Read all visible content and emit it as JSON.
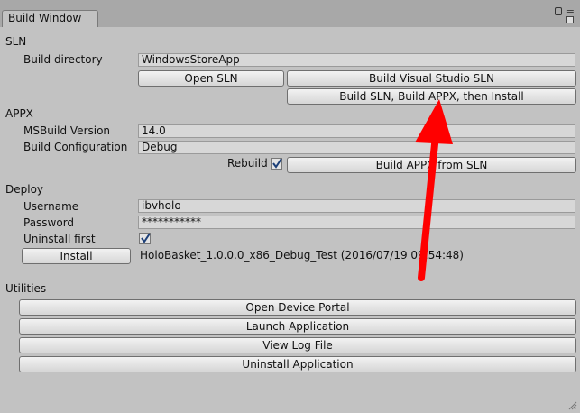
{
  "tab": {
    "label": "Build Window"
  },
  "sln": {
    "section_label": "SLN",
    "build_dir_label": "Build directory",
    "build_dir_value": "WindowsStoreApp",
    "open_sln_label": "Open SLN",
    "build_vs_sln_label": "Build Visual Studio SLN",
    "build_all_label": "Build SLN, Build APPX, then Install"
  },
  "appx": {
    "section_label": "APPX",
    "msbuild_label": "MSBuild Version",
    "msbuild_value": "14.0",
    "config_label": "Build Configuration",
    "config_value": "Debug",
    "rebuild_label": "Rebuild",
    "rebuild_checked": true,
    "build_appx_label": "Build APPX from SLN"
  },
  "deploy": {
    "section_label": "Deploy",
    "username_label": "Username",
    "username_value": "ibvholo",
    "password_label": "Password",
    "password_value": "***********",
    "uninstall_first_label": "Uninstall first",
    "uninstall_first_checked": true,
    "install_label": "Install",
    "package_info": "HoloBasket_1.0.0.0_x86_Debug_Test (2016/07/19 09:54:48)"
  },
  "utilities": {
    "section_label": "Utilities",
    "open_portal_label": "Open Device Portal",
    "launch_label": "Launch Application",
    "view_log_label": "View Log File",
    "uninstall_label": "Uninstall Application"
  },
  "colors": {
    "window_bg": "#c2c2c2",
    "annotation_arrow": "#ff0000"
  },
  "icons": [
    "lock-icon",
    "menu-icon",
    "close-icon",
    "checkmark-icon",
    "resize-grip-icon",
    "annotation-arrow"
  ]
}
